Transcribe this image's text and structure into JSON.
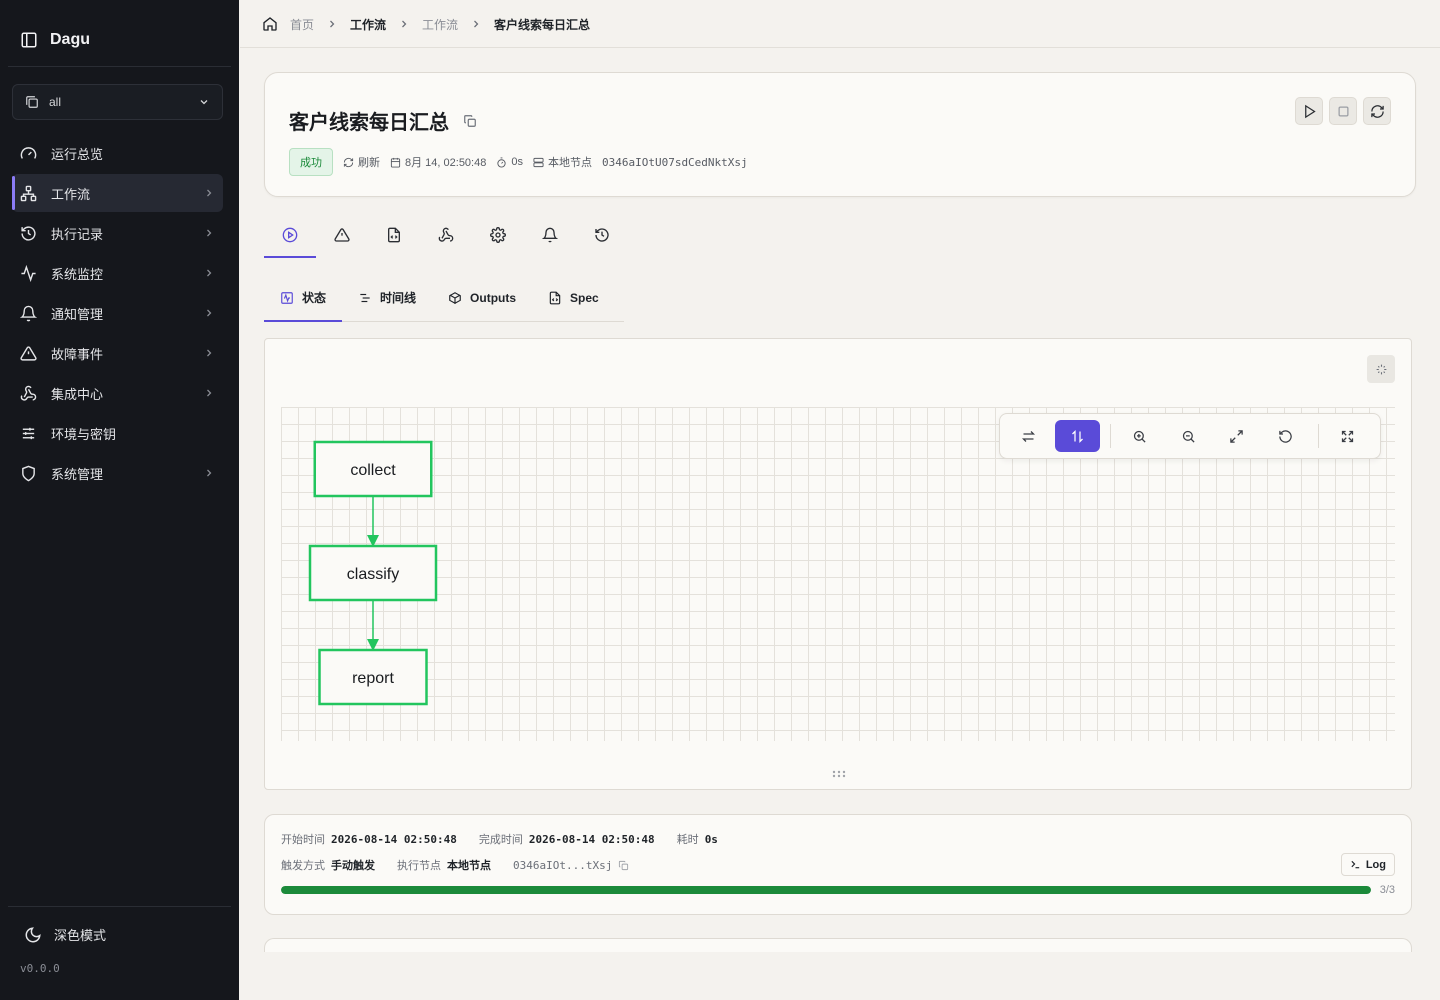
{
  "sidebar": {
    "brand": "Dagu",
    "namespace": "all",
    "items": [
      {
        "label": "运行总览"
      },
      {
        "label": "工作流"
      },
      {
        "label": "执行记录"
      },
      {
        "label": "系统监控"
      },
      {
        "label": "通知管理"
      },
      {
        "label": "故障事件"
      },
      {
        "label": "集成中心"
      },
      {
        "label": "环境与密钥"
      },
      {
        "label": "系统管理"
      }
    ],
    "dark_mode": "深色模式",
    "version": "v0.0.0"
  },
  "breadcrumb": [
    "首页",
    "工作流",
    "工作流",
    "客户线索每日汇总"
  ],
  "header": {
    "title": "客户线索每日汇总",
    "status": "成功",
    "status_color": "#1b8a3a",
    "refresh": "刷新",
    "datetime": "8月 14, 02:50:48",
    "duration": "0s",
    "node": "本地节点",
    "run_id": "0346aIOtU07sdCedNktXsj"
  },
  "sub_tabs": [
    "状态",
    "时间线",
    "Outputs",
    "Spec"
  ],
  "graph": {
    "nodes": [
      "collect",
      "classify",
      "report"
    ],
    "edges": [
      [
        "collect",
        "classify"
      ],
      [
        "classify",
        "report"
      ]
    ],
    "node_color": "#22c55e",
    "layout_direction": "vertical"
  },
  "info": {
    "start_label": "开始时间",
    "start_value": "2026-08-14 02:50:48",
    "end_label": "完成时间",
    "end_value": "2026-08-14 02:50:48",
    "duration_label": "耗时",
    "duration_value": "0s",
    "trigger_label": "触发方式",
    "trigger_value": "手动触发",
    "node_label": "执行节点",
    "node_value": "本地节点",
    "run_id_short": "0346aIOt...tXsj",
    "log_button": "Log",
    "progress_text": "3/3",
    "progress_fraction": 1.0
  },
  "colors": {
    "accent": "#5a4bd8",
    "success": "#1b8a3a",
    "sidebar_bg": "#15171c"
  }
}
